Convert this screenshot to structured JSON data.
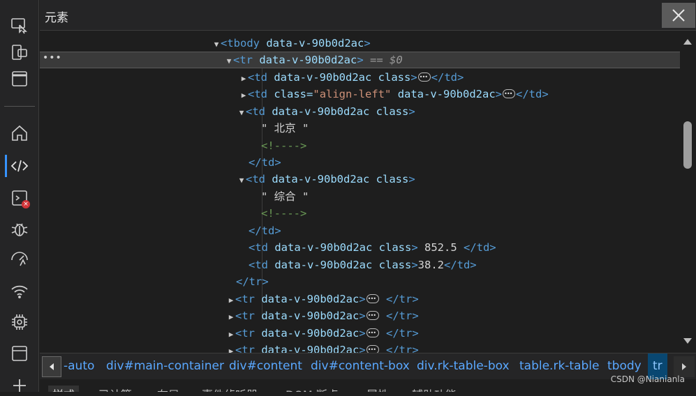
{
  "panel": {
    "title": "元素",
    "close_label": "close"
  },
  "activity_bar": {
    "icons": [
      "inspect-icon",
      "device-emulation-icon",
      "layout-icon",
      "home-icon",
      "elements-icon",
      "console-icon",
      "sources-debug-icon",
      "performance-icon",
      "network-icon",
      "memory-icon",
      "application-icon",
      "add-icon"
    ],
    "active": "elements-icon",
    "console_badge": "×"
  },
  "tree": {
    "selected_suffix": "== $0",
    "row_menu": "•••",
    "lines": {
      "l0": {
        "tag": "<tbody",
        "attr": "data-v-90b0d2ac",
        "close": ">"
      },
      "l1": {
        "tag": "<tr",
        "attr": "data-v-90b0d2ac",
        "close": ">"
      },
      "l2": {
        "tag": "<td",
        "attr": "data-v-90b0d2ac class",
        "close": ">",
        "end": "</td>"
      },
      "l3": {
        "tag": "<td",
        "attr1": "class",
        "eq": "=",
        "val": "\"align-left\"",
        "attr2": "data-v-90b0d2ac",
        "close": ">",
        "end": "</td>"
      },
      "l4": {
        "tag": "<td",
        "attr": "data-v-90b0d2ac class",
        "close": ">"
      },
      "l5": {
        "text": "\" 北京 \""
      },
      "l6": {
        "comment": "<!---->"
      },
      "l7": {
        "tag": "</td>"
      },
      "l8": {
        "tag": "<td",
        "attr": "data-v-90b0d2ac class",
        "close": ">"
      },
      "l9": {
        "text": "\" 综合 \""
      },
      "l10": {
        "comment": "<!---->"
      },
      "l11": {
        "tag": "</td>"
      },
      "l12": {
        "tag": "<td",
        "attr": "data-v-90b0d2ac class",
        "close": ">",
        "text": " 852.5 ",
        "end": "</td>"
      },
      "l13": {
        "tag": "<td",
        "attr": "data-v-90b0d2ac class",
        "close": ">",
        "text": "38.2",
        "end": "</td>"
      },
      "l14": {
        "tag": "</tr>"
      },
      "l15": {
        "tag": "<tr",
        "attr": "data-v-90b0d2ac",
        "close": ">",
        "end": "</tr>"
      },
      "l16": {
        "tag": "<tr",
        "attr": "data-v-90b0d2ac",
        "close": ">",
        "end": "</tr>"
      },
      "l17": {
        "tag": "<tr",
        "attr": "data-v-90b0d2ac",
        "close": ">",
        "end": "</tr>"
      },
      "l18": {
        "tag": "<tr",
        "attr": "data-v-90b0d2ac",
        "close": ">",
        "end": "</tr>"
      }
    }
  },
  "breadcrumb": {
    "items": [
      "-auto",
      "div#main-container",
      "div#content",
      "div#content-box",
      "div.rk-table-box",
      "table.rk-table",
      "tbody",
      "tr"
    ],
    "active_index": 7
  },
  "bottom_tabs": [
    "样式",
    "已计算",
    "布局",
    "事件侦听器",
    "DOM 断点",
    "属性",
    "辅助功能"
  ],
  "watermark": "CSDN @Nianianla",
  "colors": {
    "tag": "#569cd6",
    "attribute": "#9cdcfe",
    "value": "#ce9178",
    "comment": "#6a9955",
    "breadcrumb_link": "#5aa8ff",
    "active_marker": "#3794ff"
  }
}
